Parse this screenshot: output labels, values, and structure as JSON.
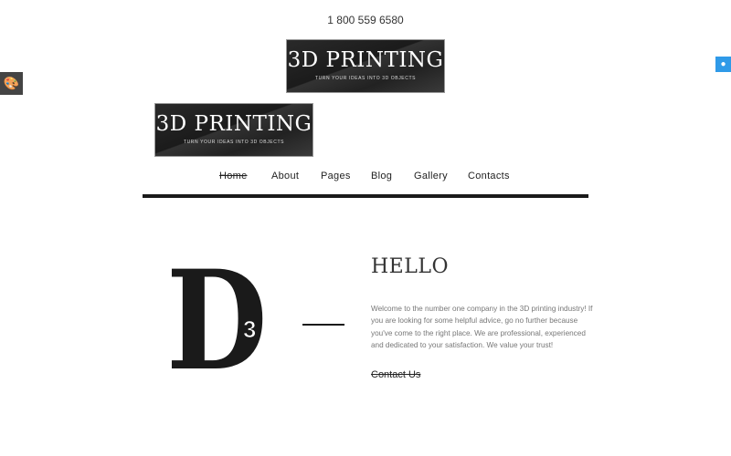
{
  "header": {
    "phone": "1 800 559 6580"
  },
  "logo": {
    "title": "3D PRINTING",
    "tagline": "TURN YOUR IDEAS INTO 3D OBJECTS"
  },
  "nav": {
    "items": [
      {
        "label": "Home",
        "active": true
      },
      {
        "label": "About"
      },
      {
        "label": "Pages"
      },
      {
        "label": "Blog"
      },
      {
        "label": "Gallery"
      },
      {
        "label": "Contacts"
      }
    ]
  },
  "hero": {
    "letter": "D",
    "superscript": "3",
    "heading": "HELLO",
    "text": "Welcome to the number one company in the 3D printing industry! If you are looking for some helpful advice, go no further because you've come to the right place. We are professional, experienced and dedicated to your satisfaction. We value your trust!",
    "cta": "Contact Us"
  },
  "widgets": {
    "left_icon": "palette-icon",
    "right_icon": "user-icon",
    "accent": "#2f9ae8"
  }
}
